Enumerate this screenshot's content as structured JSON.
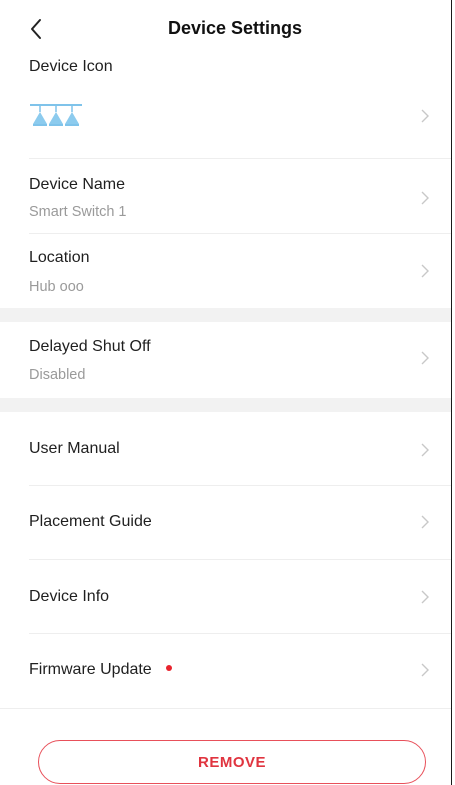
{
  "header": {
    "title": "Device Settings",
    "back_icon": "chevron-left-icon"
  },
  "device_icon": {
    "label": "Device Icon",
    "icon": "pendant-lights-icon",
    "icon_color": "#7fc3ea"
  },
  "device_name": {
    "label": "Device Name",
    "value": "Smart Switch 1"
  },
  "location": {
    "label": "Location",
    "value": "Hub ooo"
  },
  "delayed_shut_off": {
    "label": "Delayed Shut Off",
    "value": "Disabled"
  },
  "menu": {
    "user_manual": "User Manual",
    "placement_guide": "Placement Guide",
    "device_info": "Device Info",
    "firmware_update": "Firmware Update"
  },
  "firmware_update_badge_color": "#e8232d",
  "remove_button": {
    "label": "REMOVE",
    "color": "#e0343f"
  }
}
